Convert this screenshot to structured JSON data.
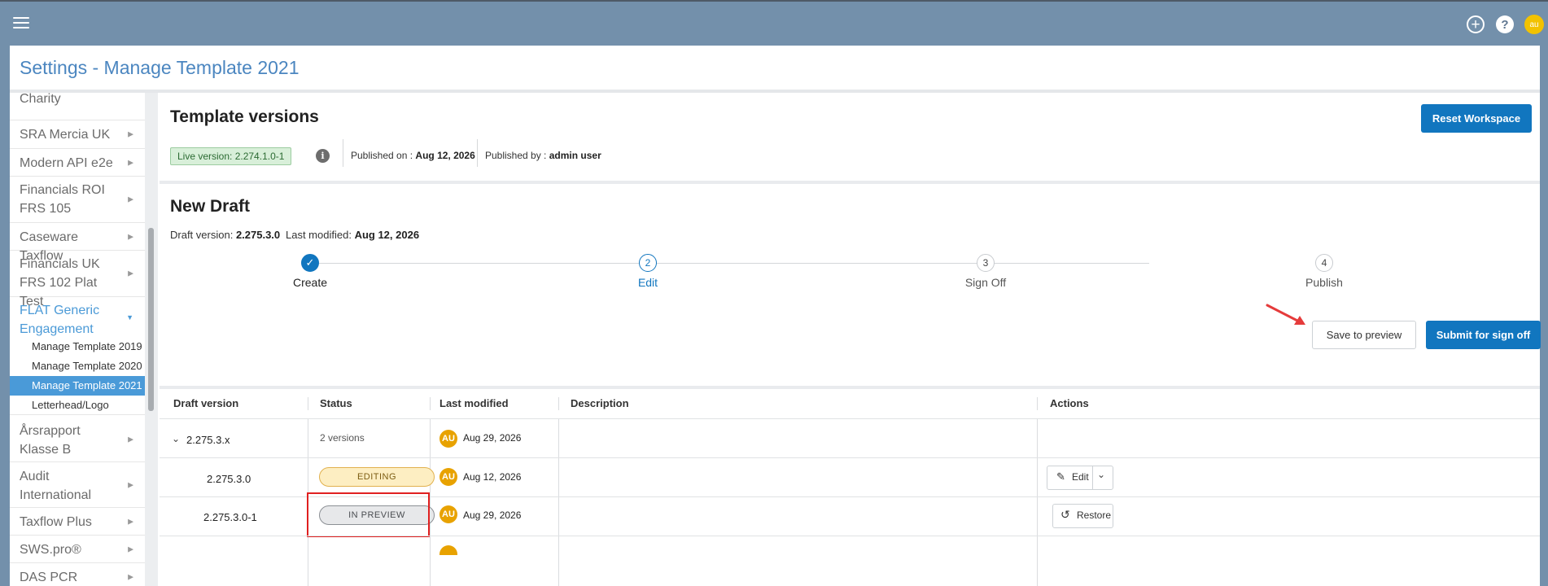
{
  "topbar": {
    "avatar_initials": "au",
    "plus_icon": "plus-circle-icon",
    "help_icon": "help-icon"
  },
  "page": {
    "title": "Settings - Manage Template 2021"
  },
  "sidebar": {
    "items": [
      {
        "label": "Charity"
      },
      {
        "label": "SRA Mercia UK"
      },
      {
        "label": "Modern API e2e"
      },
      {
        "label": "Financials ROI FRS 105"
      },
      {
        "label": "Caseware Taxflow"
      },
      {
        "label": "Financials UK FRS 102 Plat Test"
      },
      {
        "label": "FLAT Generic Engagement"
      },
      {
        "label": "Årsrapport Klasse B"
      },
      {
        "label": "Audit International"
      },
      {
        "label": "Taxflow Plus"
      },
      {
        "label": "SWS.pro®"
      },
      {
        "label": "DAS PCR"
      }
    ],
    "subitems": [
      {
        "label": "Manage Template 2019"
      },
      {
        "label": "Manage Template 2020"
      },
      {
        "label": "Manage Template 2021"
      },
      {
        "label": "Letterhead/Logo"
      }
    ]
  },
  "template_versions": {
    "title": "Template versions",
    "reset_button": "Reset Workspace",
    "live_version": "Live version: 2.274.1.0-1",
    "published_on_label": "Published on :",
    "published_on_value": "Aug 12, 2026",
    "published_by_label": "Published by :",
    "published_by_value": "admin user"
  },
  "new_draft": {
    "title": "New Draft",
    "draft_version_label": "Draft version:",
    "draft_version_value": "2.275.3.0",
    "last_modified_label": "Last modified:",
    "last_modified_value": "Aug 12, 2026",
    "steps": [
      {
        "number": "✓",
        "label": "Create",
        "state": "complete"
      },
      {
        "number": "2",
        "label": "Edit",
        "state": "current"
      },
      {
        "number": "3",
        "label": "Sign Off",
        "state": "pending"
      },
      {
        "number": "4",
        "label": "Publish",
        "state": "pending"
      }
    ],
    "save_preview_button": "Save to preview",
    "submit_button": "Submit for sign off"
  },
  "table": {
    "headers": [
      "Draft version",
      "Status",
      "Last modified",
      "Description",
      "Actions"
    ],
    "rows": [
      {
        "version": "2.275.3.x",
        "status": "2 versions",
        "avatar": "AU",
        "modified": "Aug 29, 2026"
      },
      {
        "version": "2.275.3.0",
        "status": "EDITING",
        "avatar": "AU",
        "modified": "Aug 12, 2026",
        "action": "Edit"
      },
      {
        "version": "2.275.3.0-1",
        "status": "IN PREVIEW",
        "avatar": "AU",
        "modified": "Aug 29, 2026",
        "action": "Restore"
      }
    ]
  },
  "colors": {
    "accent": "#1176bf",
    "highlight": "#e02020",
    "topbar": "#7390ab"
  }
}
